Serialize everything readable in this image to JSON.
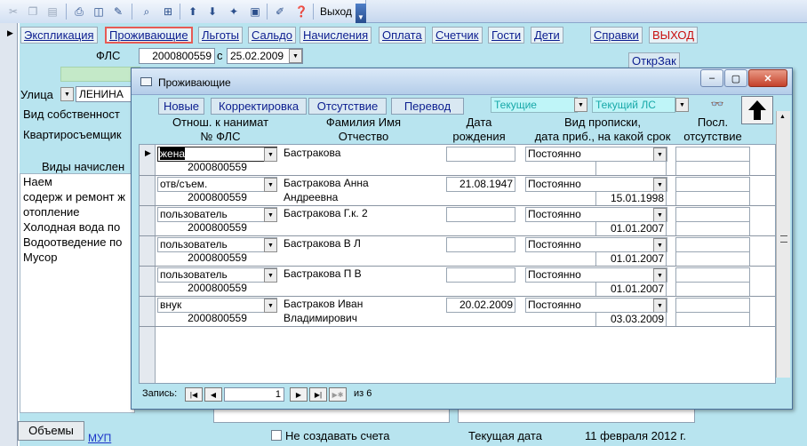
{
  "toolbar": {
    "exit_label": "Выход",
    "icons": [
      "cut-icon",
      "copy-icon",
      "paste-icon",
      "print-icon",
      "print-preview-icon",
      "spell-check-icon",
      "find-icon",
      "sort-ascending-icon",
      "sort-descending-icon",
      "filter-icon",
      "filter-apply-icon",
      "properties-icon",
      "help-icon"
    ]
  },
  "nav": {
    "explikaciya": "Экспликация",
    "prozhivayushchie": "Проживающие",
    "lgoty": "Льготы",
    "saldo": "Сальдо",
    "nachisleniya": "Начисления",
    "oplata": "Оплата",
    "schetchik": "Счетчик",
    "gosti": "Гости",
    "deti": "Дети",
    "spravki": "Справки",
    "vyhod": "ВЫХОД"
  },
  "main": {
    "fls_label": "ФЛС",
    "fls_value": "2000800559",
    "s_label": "с",
    "date_value": "25.02.2009",
    "otkrzak_label": "ОткрЗак",
    "street_label": "Улица",
    "street_value": "ЛЕНИНА",
    "vid_sobstv_label": "Вид собственност",
    "kvartirosem_label": "Квартиросъемщик",
    "vidy_nachisl_label": "Виды начислен",
    "services": [
      "Наем",
      "содерж и ремонт ж",
      "отопление",
      "Холодная вода по",
      "Водоотведение по",
      "Мусор"
    ],
    "obemy_label": "Объемы",
    "mup_label": "МУП",
    "ne_sozdavat_label": "Не создавать счета",
    "tek_data_label": "Текущая дата",
    "tek_data_value": "11 февраля 2012 г."
  },
  "dialog": {
    "title": "Проживающие",
    "buttons": {
      "novye": "Новые",
      "korrektirovka": "Корректировка",
      "otsutstvie": "Отсутствие",
      "perevod": "Перевод"
    },
    "filter1": "Текущие",
    "filter2": "Текущий ЛС",
    "headers": {
      "rel_1": "Отнош. к нанимат",
      "rel_2": "№ ФЛС",
      "name_1": "Фамилия Имя",
      "name_2": "Отчество",
      "birth_1": "Дата",
      "birth_2": "рождения",
      "reg_1": "Вид прописки,",
      "reg_2": "дата приб., на какой срок",
      "abs_1": "Посл.",
      "abs_2": "отсутствие"
    },
    "rows": [
      {
        "relation": "жена",
        "fls": "2000800559",
        "name1": "Бастракова",
        "name2": "",
        "birth": "",
        "reg_type": "Постоянно",
        "reg_date": ""
      },
      {
        "relation": "отв/съем.",
        "fls": "2000800559",
        "name1": "Бастракова Анна",
        "name2": "Андреевна",
        "birth": "21.08.1947",
        "reg_type": "Постоянно",
        "reg_date": "15.01.1998"
      },
      {
        "relation": "пользователь",
        "fls": "2000800559",
        "name1": "Бастракова Г.к. 2",
        "name2": "",
        "birth": "",
        "reg_type": "Постоянно",
        "reg_date": "01.01.2007"
      },
      {
        "relation": "пользователь",
        "fls": "2000800559",
        "name1": "Бастракова В Л",
        "name2": "",
        "birth": "",
        "reg_type": "Постоянно",
        "reg_date": "01.01.2007"
      },
      {
        "relation": "пользователь",
        "fls": "2000800559",
        "name1": "Бастракова П В",
        "name2": "",
        "birth": "",
        "reg_type": "Постоянно",
        "reg_date": "01.01.2007"
      },
      {
        "relation": "внук",
        "fls": "2000800559",
        "name1": "Бастраков Иван",
        "name2": "Владимирович",
        "birth": "20.02.2009",
        "reg_type": "Постоянно",
        "reg_date": "03.03.2009"
      }
    ],
    "status": {
      "record_label": "Запись:",
      "record_value": "1",
      "of_label": "из 6"
    }
  }
}
